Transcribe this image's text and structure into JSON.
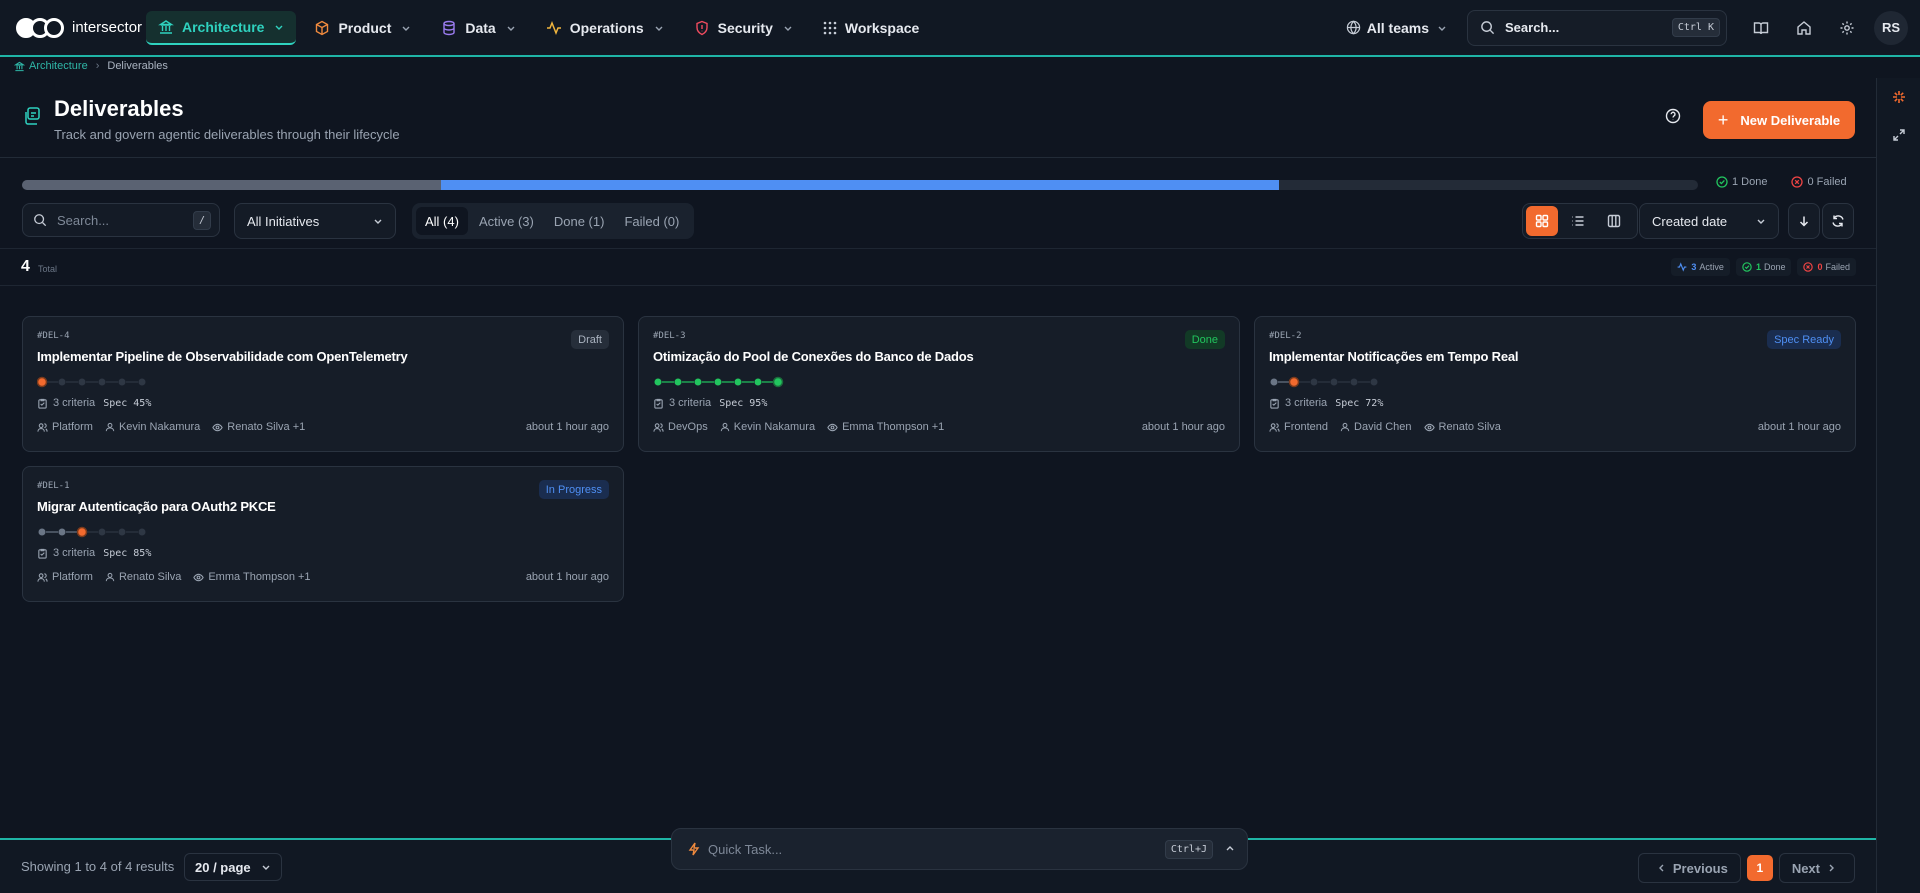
{
  "app": {
    "name": "intersector"
  },
  "nav": {
    "items": [
      {
        "label": "Architecture",
        "icon": "building-icon",
        "active": true
      },
      {
        "label": "Product",
        "icon": "cube-icon"
      },
      {
        "label": "Data",
        "icon": "database-icon"
      },
      {
        "label": "Operations",
        "icon": "activity-icon"
      },
      {
        "label": "Security",
        "icon": "shield-icon"
      },
      {
        "label": "Workspace",
        "icon": "grid-icon"
      }
    ],
    "teams_label": "All teams",
    "search_placeholder": "Search...",
    "search_shortcut": "Ctrl K",
    "user_initials": "RS"
  },
  "breadcrumb": {
    "parent": "Architecture",
    "current": "Deliverables"
  },
  "header": {
    "title": "Deliverables",
    "subtitle": "Track and govern agentic deliverables through their lifecycle",
    "new_button": "New Deliverable"
  },
  "progress": {
    "done_fraction": 0.25,
    "active_fraction": 0.5,
    "done_label": "1 Done",
    "failed_label": "0 Failed"
  },
  "toolbar": {
    "search_placeholder": "Search...",
    "search_shortcut": "/",
    "initiative_filter": "All Initiatives",
    "tabs": [
      "All (4)",
      "Active (3)",
      "Done (1)",
      "Failed (0)"
    ],
    "active_tab": 0,
    "sort_label": "Created date"
  },
  "stats": {
    "total": "4",
    "total_label": "Total",
    "active_count": "3",
    "active_label": "Active",
    "done_count": "1",
    "done_label": "Done",
    "failed_count": "0",
    "failed_label": "Failed"
  },
  "colors": {
    "accent": "#f26a2e",
    "teal": "#2fd2bf",
    "active_blue": "#4f8ff3",
    "done_green": "#22c55e",
    "failed_red": "#ef4444"
  },
  "deliverables": [
    {
      "id": "#DEL-4",
      "title": "Implementar Pipeline de Observabilidade com OpenTelemetry",
      "status": "Draft",
      "stage_current": 1,
      "stage_total": 6,
      "criteria": "3 criteria",
      "spec_label": "Spec",
      "spec_value": "45%",
      "team": "Platform",
      "owner": "Kevin Nakamura",
      "watchers": "Renato Silva +1",
      "updated": "about 1 hour ago"
    },
    {
      "id": "#DEL-3",
      "title": "Otimização do Pool de Conexões do Banco de Dados",
      "status": "Done",
      "stage_current": 7,
      "stage_total": 7,
      "criteria": "3 criteria",
      "spec_label": "Spec",
      "spec_value": "95%",
      "team": "DevOps",
      "owner": "Kevin Nakamura",
      "watchers": "Emma Thompson +1",
      "updated": "about 1 hour ago"
    },
    {
      "id": "#DEL-2",
      "title": "Implementar Notificações em Tempo Real",
      "status": "Spec Ready",
      "stage_current": 2,
      "stage_total": 6,
      "criteria": "3 criteria",
      "spec_label": "Spec",
      "spec_value": "72%",
      "team": "Frontend",
      "owner": "David Chen",
      "watchers": "Renato Silva",
      "updated": "about 1 hour ago"
    },
    {
      "id": "#DEL-1",
      "title": "Migrar Autenticação para OAuth2 PKCE",
      "status": "In Progress",
      "stage_current": 3,
      "stage_total": 6,
      "criteria": "3 criteria",
      "spec_label": "Spec",
      "spec_value": "85%",
      "team": "Platform",
      "owner": "Renato Silva",
      "watchers": "Emma Thompson +1",
      "updated": "about 1 hour ago"
    }
  ],
  "footer": {
    "showing": "Showing 1 to 4 of 4 results",
    "per_page": "20 / page",
    "previous": "Previous",
    "page": "1",
    "next": "Next"
  },
  "quick_task": {
    "placeholder": "Quick Task...",
    "shortcut": "Ctrl+J"
  }
}
